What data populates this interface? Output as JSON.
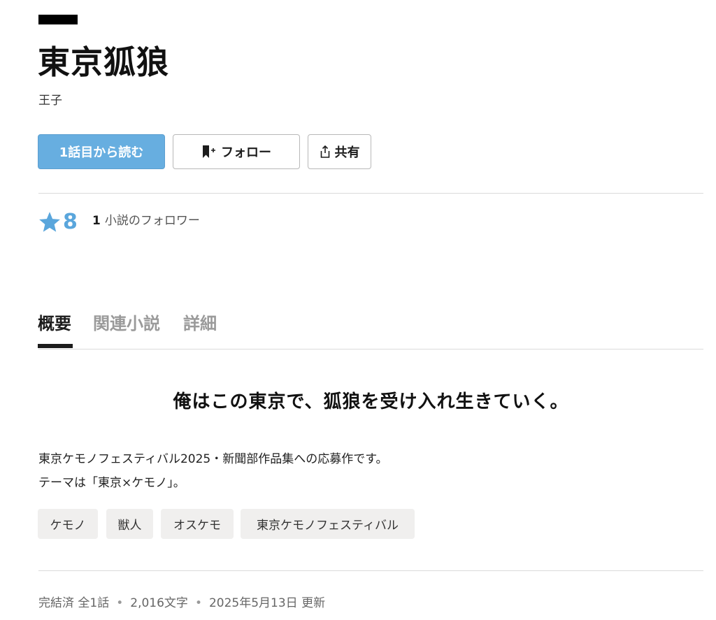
{
  "work": {
    "title": "東京狐狼",
    "author": "王子"
  },
  "actions": {
    "read_label": "1話目から読む",
    "follow_label": "フォロー",
    "share_label": "共有"
  },
  "stats": {
    "stars": "8",
    "follower_count": "1",
    "follower_label": "小説のフォロワー"
  },
  "tabs": [
    {
      "label": "概要",
      "active": true
    },
    {
      "label": "関連小説",
      "active": false
    },
    {
      "label": "詳細",
      "active": false
    }
  ],
  "summary": {
    "catchphrase": "俺はこの東京で、狐狼を受け入れ生きていく。",
    "intro_lines": [
      "東京ケモノフェスティバル2025・新聞部作品集への応募作です。",
      "テーマは「東京×ケモノ」。"
    ],
    "tags": [
      "ケモノ",
      "獣人",
      "オスケモ",
      "東京ケモノフェスティバル"
    ]
  },
  "meta": {
    "status": "完結済 全1話",
    "chars": "2,016文字",
    "updated": "2025年5月13日 更新"
  },
  "colors": {
    "accent": "#67aee0",
    "star": "#5aa6dc",
    "tag_bg": "#f0efee"
  }
}
